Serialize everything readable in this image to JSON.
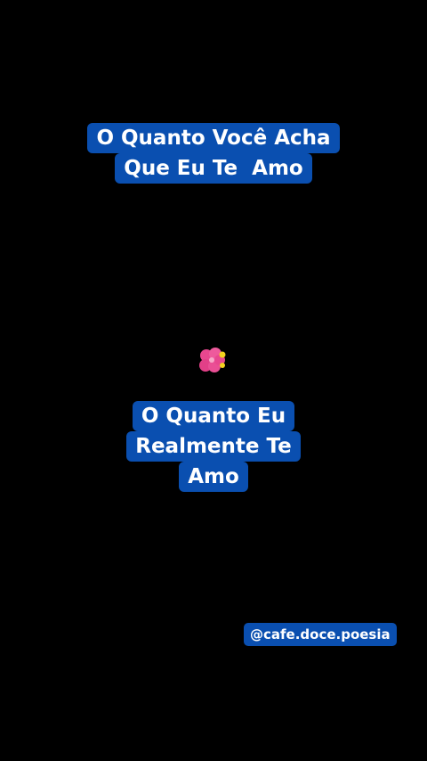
{
  "captions": {
    "top": {
      "line1": "O Quanto Você Acha",
      "line2": "Que Eu Te  Amo"
    },
    "bottom": {
      "line1": "O Quanto Eu",
      "line2": "Realmente Te",
      "line3": "Amo"
    }
  },
  "decoration": {
    "icon": "flower-icon"
  },
  "watermark": {
    "handle": "@cafe.doce.poesia"
  },
  "colors": {
    "background": "#000000",
    "caption_bg": "#0a4fb0",
    "caption_text": "#ffffff",
    "flower_pink": "#e8478f",
    "flower_yellow": "#f5d21f"
  }
}
